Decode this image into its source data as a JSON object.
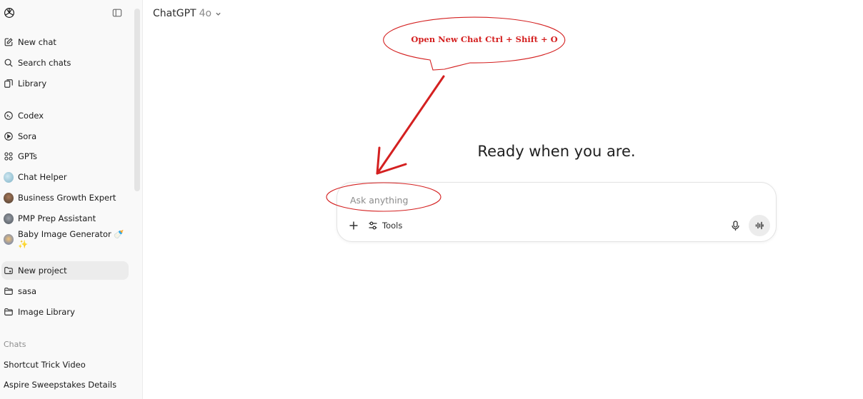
{
  "sidebar": {
    "nav": [
      {
        "label": "New chat",
        "icon": "new-chat-icon"
      },
      {
        "label": "Search chats",
        "icon": "search-icon"
      },
      {
        "label": "Library",
        "icon": "library-icon"
      }
    ],
    "tools": [
      {
        "label": "Codex",
        "icon": "terminal-icon"
      },
      {
        "label": "Sora",
        "icon": "play-circle-icon"
      },
      {
        "label": "GPTs",
        "icon": "grid-icon"
      },
      {
        "label": "Chat Helper",
        "icon": "avatar"
      },
      {
        "label": "Business Growth Expert",
        "icon": "avatar"
      },
      {
        "label": "PMP Prep Assistant",
        "icon": "avatar"
      },
      {
        "label": "Baby Image Generator 🍼✨",
        "icon": "avatar"
      }
    ],
    "projects": [
      {
        "label": "New project",
        "icon": "new-folder-icon"
      },
      {
        "label": "sasa",
        "icon": "folder-icon"
      },
      {
        "label": "Image Library",
        "icon": "folder-icon"
      }
    ],
    "chats_label": "Chats",
    "chats": [
      "Shortcut Trick Video",
      "Aspire Sweepstakes Details"
    ]
  },
  "header": {
    "model_name": "ChatGPT",
    "model_version": "4o"
  },
  "main": {
    "hero": "Ready when you are.",
    "composer": {
      "placeholder": "Ask anything",
      "tools_label": "Tools"
    }
  },
  "annotation": {
    "callout": "Open New Chat Ctrl + Shift + O",
    "color": "#d42020"
  }
}
